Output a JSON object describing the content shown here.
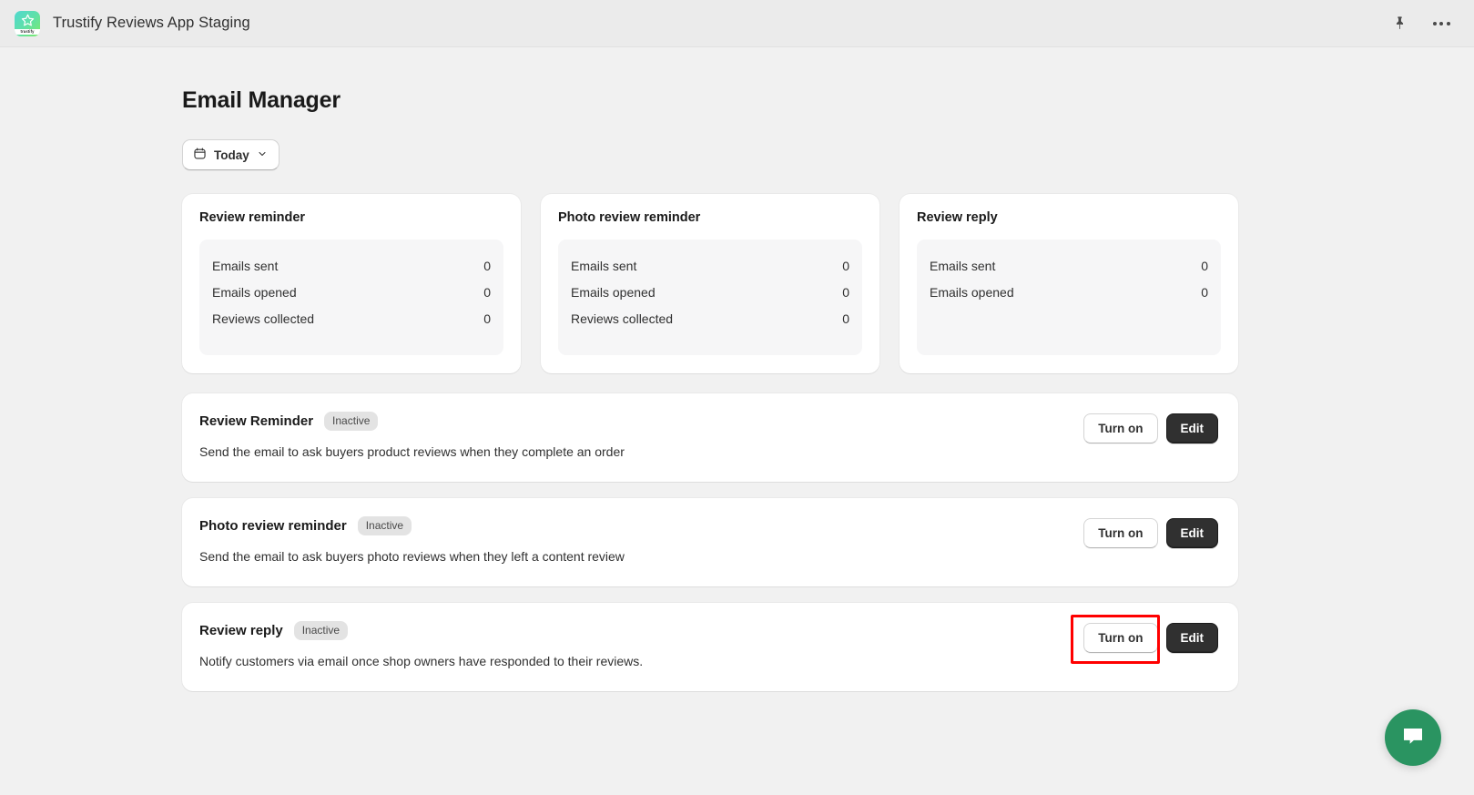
{
  "topbar": {
    "logo_word": "trustify",
    "app_title": "Trustify Reviews App Staging",
    "pin_icon": "pin-icon",
    "more_icon": "more-horizontal-icon"
  },
  "page": {
    "title": "Email Manager"
  },
  "date_filter": {
    "label": "Today",
    "icon": "calendar-icon",
    "chevron": "chevron-down-icon"
  },
  "stat_cards": [
    {
      "title": "Review reminder",
      "rows": [
        {
          "label": "Emails sent",
          "value": "0"
        },
        {
          "label": "Emails opened",
          "value": "0"
        },
        {
          "label": "Reviews collected",
          "value": "0"
        }
      ]
    },
    {
      "title": "Photo review reminder",
      "rows": [
        {
          "label": "Emails sent",
          "value": "0"
        },
        {
          "label": "Emails opened",
          "value": "0"
        },
        {
          "label": "Reviews collected",
          "value": "0"
        }
      ]
    },
    {
      "title": "Review reply",
      "rows": [
        {
          "label": "Emails sent",
          "value": "0"
        },
        {
          "label": "Emails opened",
          "value": "0"
        }
      ]
    }
  ],
  "features": [
    {
      "title": "Review Reminder",
      "status": "Inactive",
      "description": "Send the email to ask buyers product reviews when they complete an order",
      "toggle_label": "Turn on",
      "edit_label": "Edit",
      "highlighted": false
    },
    {
      "title": "Photo review reminder",
      "status": "Inactive",
      "description": "Send the email to ask buyers photo reviews when they left a content review",
      "toggle_label": "Turn on",
      "edit_label": "Edit",
      "highlighted": false
    },
    {
      "title": "Review reply",
      "status": "Inactive",
      "description": "Notify customers via email once shop owners have responded to their reviews.",
      "toggle_label": "Turn on",
      "edit_label": "Edit",
      "highlighted": true
    }
  ],
  "chat": {
    "icon": "chat-bubble-icon"
  },
  "colors": {
    "page_background": "#f1f1f1",
    "topbar_background": "#ebebeb",
    "card_background": "#ffffff",
    "panel_background": "#f6f6f7",
    "primary_button": "#303030",
    "badge_background": "#e3e3e3",
    "chat_green": "#2a9461",
    "highlight_red": "#ff0000"
  }
}
